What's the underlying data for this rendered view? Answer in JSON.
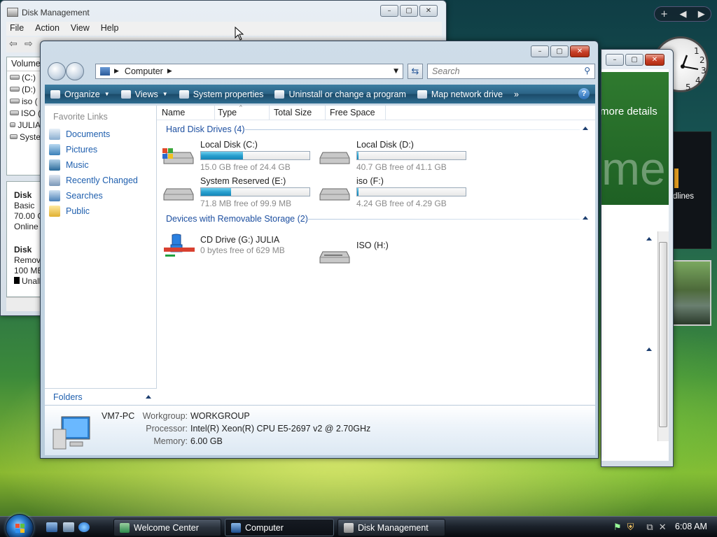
{
  "disk_management": {
    "title": "Disk Management",
    "menu": [
      "File",
      "Action",
      "View",
      "Help"
    ],
    "list_header": "Volume",
    "volumes": [
      "(C:)",
      "(D:)",
      "iso (",
      "ISO (",
      "JULIA",
      "Syste"
    ],
    "disk0": {
      "name": "Disk",
      "type": "Basic",
      "size": "70.00 G",
      "status": "Online"
    },
    "disk1": {
      "name": "Disk",
      "type": "Remov",
      "size": "100 MB",
      "legend": "Unallo"
    }
  },
  "welcome_center": {
    "banner_text": "more details",
    "big_text": "me",
    "headlines": "dlines"
  },
  "sidebar": {
    "controls": [
      "+",
      "◀",
      "▶"
    ]
  },
  "computer_window": {
    "address": "Computer",
    "search_placeholder": "Search",
    "commands": [
      "Organize",
      "Views",
      "System properties",
      "Uninstall or change a program",
      "Map network drive",
      "»"
    ],
    "favorite_links_title": "Favorite Links",
    "favorite_links": [
      "Documents",
      "Pictures",
      "Music",
      "Recently Changed",
      "Searches",
      "Public"
    ],
    "folders_label": "Folders",
    "columns": [
      "Name",
      "Type",
      "Total Size",
      "Free Space"
    ],
    "hard_disk_group": "Hard Disk Drives (4)",
    "removable_group": "Devices with Removable Storage (2)",
    "hard_disks": [
      {
        "name": "Local Disk (C:)",
        "free_text": "15.0 GB free of 24.4 GB",
        "used_fraction": 0.39
      },
      {
        "name": "Local Disk (D:)",
        "free_text": "40.7 GB free of 41.1 GB",
        "used_fraction": 0.01
      },
      {
        "name": "System Reserved (E:)",
        "free_text": "71.8 MB free of 99.9 MB",
        "used_fraction": 0.28
      },
      {
        "name": "iso (F:)",
        "free_text": "4.24 GB free of 4.29 GB",
        "used_fraction": 0.01
      }
    ],
    "removable": [
      {
        "name": "CD Drive (G:) JULIA",
        "free_text": "0 bytes free of 629 MB"
      },
      {
        "name": "ISO (H:)",
        "free_text": ""
      }
    ],
    "details": {
      "computer_name": "VM7-PC",
      "workgroup_label": "Workgroup:",
      "workgroup": "WORKGROUP",
      "processor_label": "Processor:",
      "processor": "Intel(R) Xeon(R) CPU E5-2697 v2 @ 2.70GHz",
      "memory_label": "Memory:",
      "memory": "6.00 GB"
    }
  },
  "taskbar": {
    "buttons": [
      "Welcome Center",
      "Computer",
      "Disk Management"
    ],
    "clock": "6:08 AM"
  },
  "colors": {
    "accent_link": "#1f5fae",
    "bar_fill": "#2aa0cf",
    "cmdbar": "#2b6386"
  }
}
